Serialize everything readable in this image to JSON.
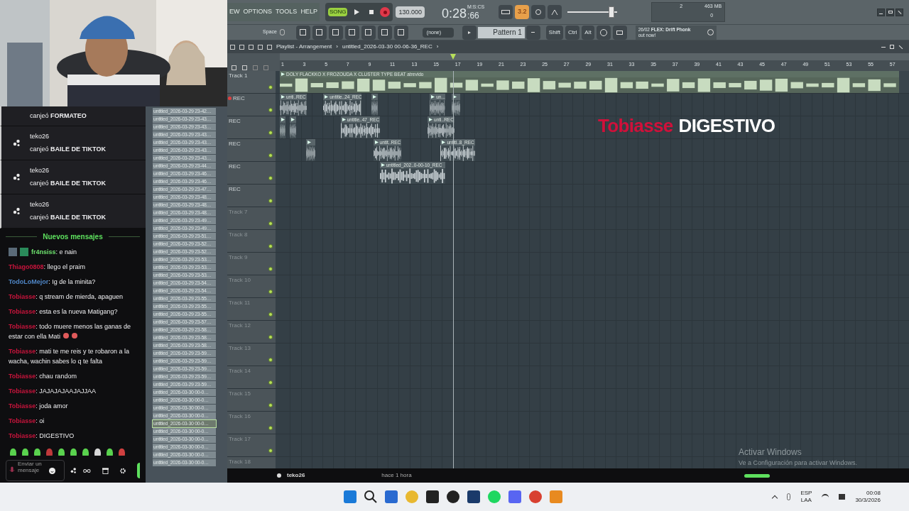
{
  "chat": {
    "redemptions": [
      {
        "action": "canjeó",
        "reward": "FORMATEO"
      },
      {
        "user": "teko26",
        "action": "canjeó",
        "reward": "BAILE DE TIKTOK"
      },
      {
        "user": "teko26",
        "action": "canjeó",
        "reward": "BAILE DE TIKTOK"
      },
      {
        "user": "teko26",
        "action": "canjeó",
        "reward": "BAILE DE TIKTOK"
      }
    ],
    "divider": "Nuevos mensajes",
    "messages": [
      {
        "user": "fr4nsiss",
        "color": "#6ee26e",
        "badges": true,
        "emojis": false,
        "text": ": e nain"
      },
      {
        "user": "Thiago0808",
        "color": "#c8143c",
        "badges": false,
        "emojis": false,
        "text": ": llego el praim"
      },
      {
        "user": "TodoLoMejor",
        "color": "#4f86c6",
        "badges": false,
        "emojis": false,
        "text": ": Ig de la minita?"
      },
      {
        "user": "Tobiasse",
        "color": "#c8143c",
        "badges": false,
        "emojis": false,
        "text": ": q stream de mierda, apaguen"
      },
      {
        "user": "Tobiasse",
        "color": "#c8143c",
        "badges": false,
        "emojis": false,
        "text": ": esta es la nueva Matigang?"
      },
      {
        "user": "Tobiasse",
        "color": "#c8143c",
        "badges": false,
        "emojis": true,
        "text": ": todo muere menos las ganas de estar con ella Mati"
      },
      {
        "user": "Tobiasse",
        "color": "#c8143c",
        "badges": false,
        "emojis": false,
        "text": ": mati te me reis y te robaron a la wacha, wachin sabes lo q te falta"
      },
      {
        "user": "Tobiasse",
        "color": "#c8143c",
        "badges": false,
        "emojis": false,
        "text": ": chau random"
      },
      {
        "user": "Tobiasse",
        "color": "#c8143c",
        "badges": false,
        "emojis": false,
        "text": ": JAJAJAJAAJAJJAA"
      },
      {
        "user": "Tobiasse",
        "color": "#c8143c",
        "badges": false,
        "emojis": false,
        "text": ": joda amor"
      },
      {
        "user": "Tobiasse",
        "color": "#c8143c",
        "badges": false,
        "emojis": false,
        "text": ": oi"
      },
      {
        "user": "Tobiasse",
        "color": "#c8143c",
        "badges": false,
        "emojis": false,
        "text": ": DIGESTIVO"
      }
    ],
    "input": {
      "placeholder": "Enviar un mensaje"
    }
  },
  "browser": {
    "files": [
      {
        "name": "untitled_2026-03-29 23-42…",
        "selected": false
      },
      {
        "name": "untitled_2026-03-29 23-43…",
        "selected": false
      },
      {
        "name": "untitled_2026-03-29 23-43…",
        "selected": false
      },
      {
        "name": "untitled_2026-03-29 23-43…",
        "selected": false
      },
      {
        "name": "untitled_2026-03-29 23-43…",
        "selected": false
      },
      {
        "name": "untitled_2026-03-29 23-43…",
        "selected": false
      },
      {
        "name": "untitled_2026-03-29 23-43…",
        "selected": false
      },
      {
        "name": "untitled_2026-03-29 23-44…",
        "selected": false
      },
      {
        "name": "untitled_2026-03-29 23-46…",
        "selected": false
      },
      {
        "name": "untitled_2026-03-29 23-46…",
        "selected": false
      },
      {
        "name": "untitled_2026-03-29 23-47…",
        "selected": false
      },
      {
        "name": "untitled_2026-03-29 23-48…",
        "selected": false
      },
      {
        "name": "untitled_2026-03-29 23-48…",
        "selected": false
      },
      {
        "name": "untitled_2026-03-29 23-48…",
        "selected": false
      },
      {
        "name": "untitled_2026-03-29 23-49…",
        "selected": false
      },
      {
        "name": "untitled_2026-03-29 23-49…",
        "selected": false
      },
      {
        "name": "untitled_2026-03-29 23-51…",
        "selected": false
      },
      {
        "name": "untitled_2026-03-29 23-52…",
        "selected": false
      },
      {
        "name": "untitled_2026-03-29 23-52…",
        "selected": false
      },
      {
        "name": "untitled_2026-03-29 23-53…",
        "selected": false
      },
      {
        "name": "untitled_2026-03-29 23-53…",
        "selected": false
      },
      {
        "name": "untitled_2026-03-29 23-53…",
        "selected": false
      },
      {
        "name": "untitled_2026-03-29 23-54…",
        "selected": false
      },
      {
        "name": "untitled_2026-03-29 23-54…",
        "selected": false
      },
      {
        "name": "untitled_2026-03-29 23-55…",
        "selected": false
      },
      {
        "name": "untitled_2026-03-29 23-55…",
        "selected": false
      },
      {
        "name": "untitled_2026-03-29 23-55…",
        "selected": false
      },
      {
        "name": "untitled_2026-03-29 23-57…",
        "selected": false
      },
      {
        "name": "untitled_2026-03-29 23-58…",
        "selected": false
      },
      {
        "name": "untitled_2026-03-29 23-58…",
        "selected": false
      },
      {
        "name": "untitled_2026-03-29 23-58…",
        "selected": false
      },
      {
        "name": "untitled_2026-03-29 23-59…",
        "selected": false
      },
      {
        "name": "untitled_2026-03-29 23-59…",
        "selected": false
      },
      {
        "name": "untitled_2026-03-29 23-59…",
        "selected": false
      },
      {
        "name": "untitled_2026-03-29 23-59…",
        "selected": false
      },
      {
        "name": "untitled_2026-03-29 23-59…",
        "selected": false
      },
      {
        "name": "untitled_2026-03-30 00-0…",
        "selected": false
      },
      {
        "name": "untitled_2026-03-30 00-0…",
        "selected": false
      },
      {
        "name": "untitled_2026-03-30 00-0…",
        "selected": false
      },
      {
        "name": "untitled_2026-03-30 00-0…",
        "selected": false
      },
      {
        "name": "untitled_2026-03-30 00-0…",
        "selected": true
      },
      {
        "name": "untitled_2026-03-30 00-0…",
        "selected": false
      },
      {
        "name": "untitled_2026-03-30 00-0…",
        "selected": false
      },
      {
        "name": "untitled_2026-03-30 00-0…",
        "selected": false
      },
      {
        "name": "untitled_2026-03-30 00-0…",
        "selected": false
      },
      {
        "name": "untitled_2026-03-30 00-0…",
        "selected": false
      }
    ]
  },
  "daw": {
    "menu": [
      "EW",
      "OPTIONS",
      "TOOLS",
      "HELP"
    ],
    "song_mode": {
      "label": "SONG",
      "on": true
    },
    "recording": true,
    "tempo": "130.000",
    "time": "0:28",
    "time_cs": ":66",
    "time_unit": "M:S:CS",
    "countdown": "3.2",
    "countdown_on": true,
    "master_volume": {
      "level": 0.88
    },
    "cpu": "2",
    "memory": "463 MB",
    "polyphony": "0",
    "space_hint": "Space",
    "snap": "(none)",
    "pattern": "Pattern 1",
    "modifier_keys": [
      "Shift",
      "Ctrl",
      "Alt"
    ],
    "news": {
      "date": "26/02",
      "text": "FLEX: Drift Phonk",
      "text2": "out now!"
    },
    "playlist": {
      "breadcrumb": [
        "Playlist - Arrangement",
        "›",
        "untitled_2026-03-30 00-06-36_REC",
        "›"
      ],
      "ruler": [
        "1",
        "3",
        "5",
        "7",
        "9",
        "11",
        "13",
        "15",
        "17",
        "19",
        "21",
        "23",
        "25",
        "27",
        "29",
        "31",
        "33",
        "35",
        "37",
        "39",
        "41",
        "43",
        "45",
        "47",
        "49",
        "51",
        "53",
        "55",
        "57"
      ],
      "playhead": {
        "level": 0.275
      },
      "tracks": [
        {
          "name": "Track 1",
          "kind": "beat",
          "clips": [
            {
              "kind": "audio",
              "label": "DOLY FLACKKO X FROZOUDA X CLUSTER TYPE BEAT atrevido"
            }
          ]
        },
        {
          "name": "REC",
          "kind": "rec",
          "armed": true,
          "clips": [
            {
              "kind": "audio",
              "label": "unti..REC"
            },
            {
              "kind": "audio",
              "label": "untitle..24_REC"
            },
            {
              "kind": "audio"
            },
            {
              "kind": "audio",
              "label": "un..."
            },
            {
              "kind": "audio"
            }
          ]
        },
        {
          "name": "REC",
          "kind": "rec",
          "armed": false,
          "clips": [
            {
              "kind": "audio"
            },
            {
              "kind": "audio"
            },
            {
              "kind": "audio",
              "label": "untitle..47_REC"
            },
            {
              "kind": "audio",
              "label": "unti..REC"
            }
          ]
        },
        {
          "name": "REC",
          "kind": "rec",
          "armed": false,
          "clips": [
            {
              "kind": "audio"
            },
            {
              "kind": "audio",
              "label": "untit..REC"
            },
            {
              "kind": "audio",
              "label": "untitl..8_REC"
            }
          ]
        },
        {
          "name": "REC",
          "kind": "rec",
          "armed": false,
          "clips": [
            {
              "kind": "audio",
              "label": "untitled_202..0-00-10_REC"
            }
          ]
        },
        {
          "name": "REC",
          "kind": "rec",
          "armed": false
        },
        {
          "name": "Track 7",
          "kind": "empty"
        },
        {
          "name": "Track 8",
          "kind": "empty"
        },
        {
          "name": "Track 9",
          "kind": "empty"
        },
        {
          "name": "Track 10",
          "kind": "empty"
        },
        {
          "name": "Track 11",
          "kind": "empty"
        },
        {
          "name": "Track 12",
          "kind": "empty"
        },
        {
          "name": "Track 13",
          "kind": "empty"
        },
        {
          "name": "Track 14",
          "kind": "empty"
        },
        {
          "name": "Track 15",
          "kind": "empty"
        },
        {
          "name": "Track 16",
          "kind": "empty"
        },
        {
          "name": "Track 17",
          "kind": "empty"
        },
        {
          "name": "Track 18",
          "kind": "empty"
        }
      ]
    }
  },
  "overlay": {
    "user": "Tobiasse",
    "message": "DIGESTIVO"
  },
  "stream_bar": {
    "user": "teko26",
    "time": "hace 1 hora"
  },
  "activation": {
    "title": "Activar Windows",
    "text": "Ve a Configuración para activar Windows."
  },
  "taskbar": {
    "language": "ESP",
    "layout": "LAA",
    "time": "00:08",
    "date": "30/3/2026"
  }
}
